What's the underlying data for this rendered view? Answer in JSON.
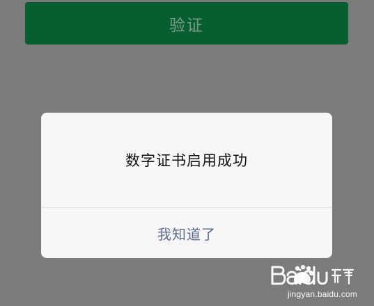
{
  "verify_button": {
    "label": "验证"
  },
  "dialog": {
    "message": "数字证书启用成功",
    "confirm_label": "我知道了"
  },
  "watermark": {
    "logo_text": "Baidu经验",
    "domain": "jingyan.baidu.com"
  },
  "colors": {
    "overlay_background": "#7b7b7b",
    "verify_button_bg": "#055f31",
    "dialog_bg": "#f8f6f8",
    "action_text": "#5b6c8f"
  }
}
